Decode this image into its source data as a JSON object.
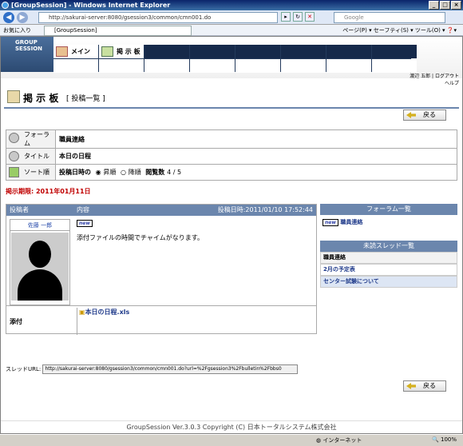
{
  "window": {
    "title": "[GroupSession] - Windows Internet Explorer",
    "buttons": [
      "_",
      "□",
      "×"
    ]
  },
  "address": {
    "url": "http://sakurai-server:8080/gsession3/common/cmn001.do",
    "search_placeholder": "Google"
  },
  "favorites": {
    "label": "お気に入り",
    "tab": "[GroupSession]",
    "commands": "ページ(P) ▾  セーフティ(S) ▾  ツール(O) ▾  ❓▾"
  },
  "app": {
    "logo": "GROUP SESSION",
    "menu": [
      {
        "label": "メイン"
      },
      {
        "label": "掲 示 板"
      }
    ],
    "user": "渡辺 五郎",
    "logout": "ログアウト",
    "help": "ヘルプ"
  },
  "page": {
    "title": "掲 示 板",
    "subtitle": "[ 投稿一覧 ]",
    "back": "戻る"
  },
  "info": {
    "forum_label": "フォーラム",
    "forum_value": "職員連絡",
    "title_label": "タイトル",
    "title_value": "本日の日程",
    "sort_label": "ソート順",
    "sort_value": "投稿日時の",
    "asc": "昇順",
    "desc": "降順",
    "views_label": "閲覧数",
    "views": "4 / 5"
  },
  "limit": "掲示期限: 2011年01月11日",
  "post": {
    "head_author": "投稿者",
    "head_content": "内容",
    "head_date": "投稿日時:2011/01/10 17:52:44",
    "author": "佐藤 一郎",
    "new": "new",
    "body": "添付ファイルの時間でチャイムがなります。",
    "attach_label": "添付",
    "attach_file": "本日の日程.xls"
  },
  "forum_list": {
    "title": "フォーラム一覧",
    "items": [
      "職員連絡"
    ]
  },
  "unread": {
    "title": "未読スレッド一覧",
    "items": [
      "職員連絡",
      "2月の予定表",
      "センター試験について"
    ]
  },
  "thread_url": {
    "label": "スレッドURL:",
    "value": "http://sakurai-server:8080/gsession3/common/cmn001.do?url=%2Fgsession3%2Fbulletin%2Fbbs0"
  },
  "footer": "GroupSession Ver.3.0.3 Copyright (C) 日本トータルシステム株式会社",
  "status": {
    "zone": "インターネット",
    "zoom": "100%"
  }
}
